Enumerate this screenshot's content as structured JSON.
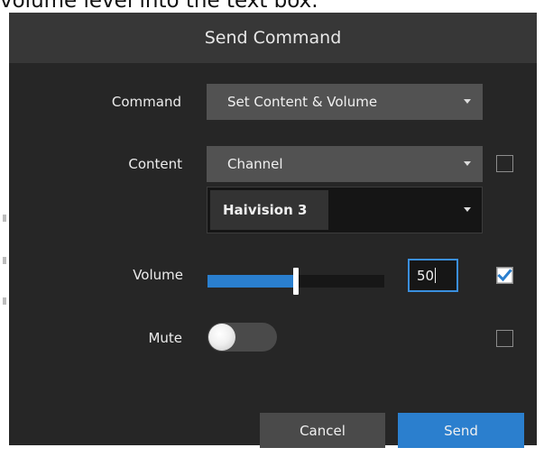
{
  "background": {
    "caption": "volume level into the text box."
  },
  "dialog": {
    "title": "Send Command"
  },
  "command": {
    "label": "Command",
    "selected": "Set Content & Volume"
  },
  "content": {
    "label": "Content",
    "type_selected": "Channel",
    "channel_selected": "Haivision 3",
    "apply_checked": false
  },
  "volume": {
    "label": "Volume",
    "value": "50",
    "slider_fraction": 0.5,
    "apply_checked": true
  },
  "mute": {
    "label": "Mute",
    "on": false,
    "apply_checked": false
  },
  "buttons": {
    "cancel": "Cancel",
    "send": "Send"
  },
  "colors": {
    "accent": "#2b7fce",
    "dialog_bg": "#262626",
    "header_bg": "#373737"
  },
  "icons": {
    "dropdown": "chevron-down-icon",
    "check": "checkmark-icon"
  }
}
